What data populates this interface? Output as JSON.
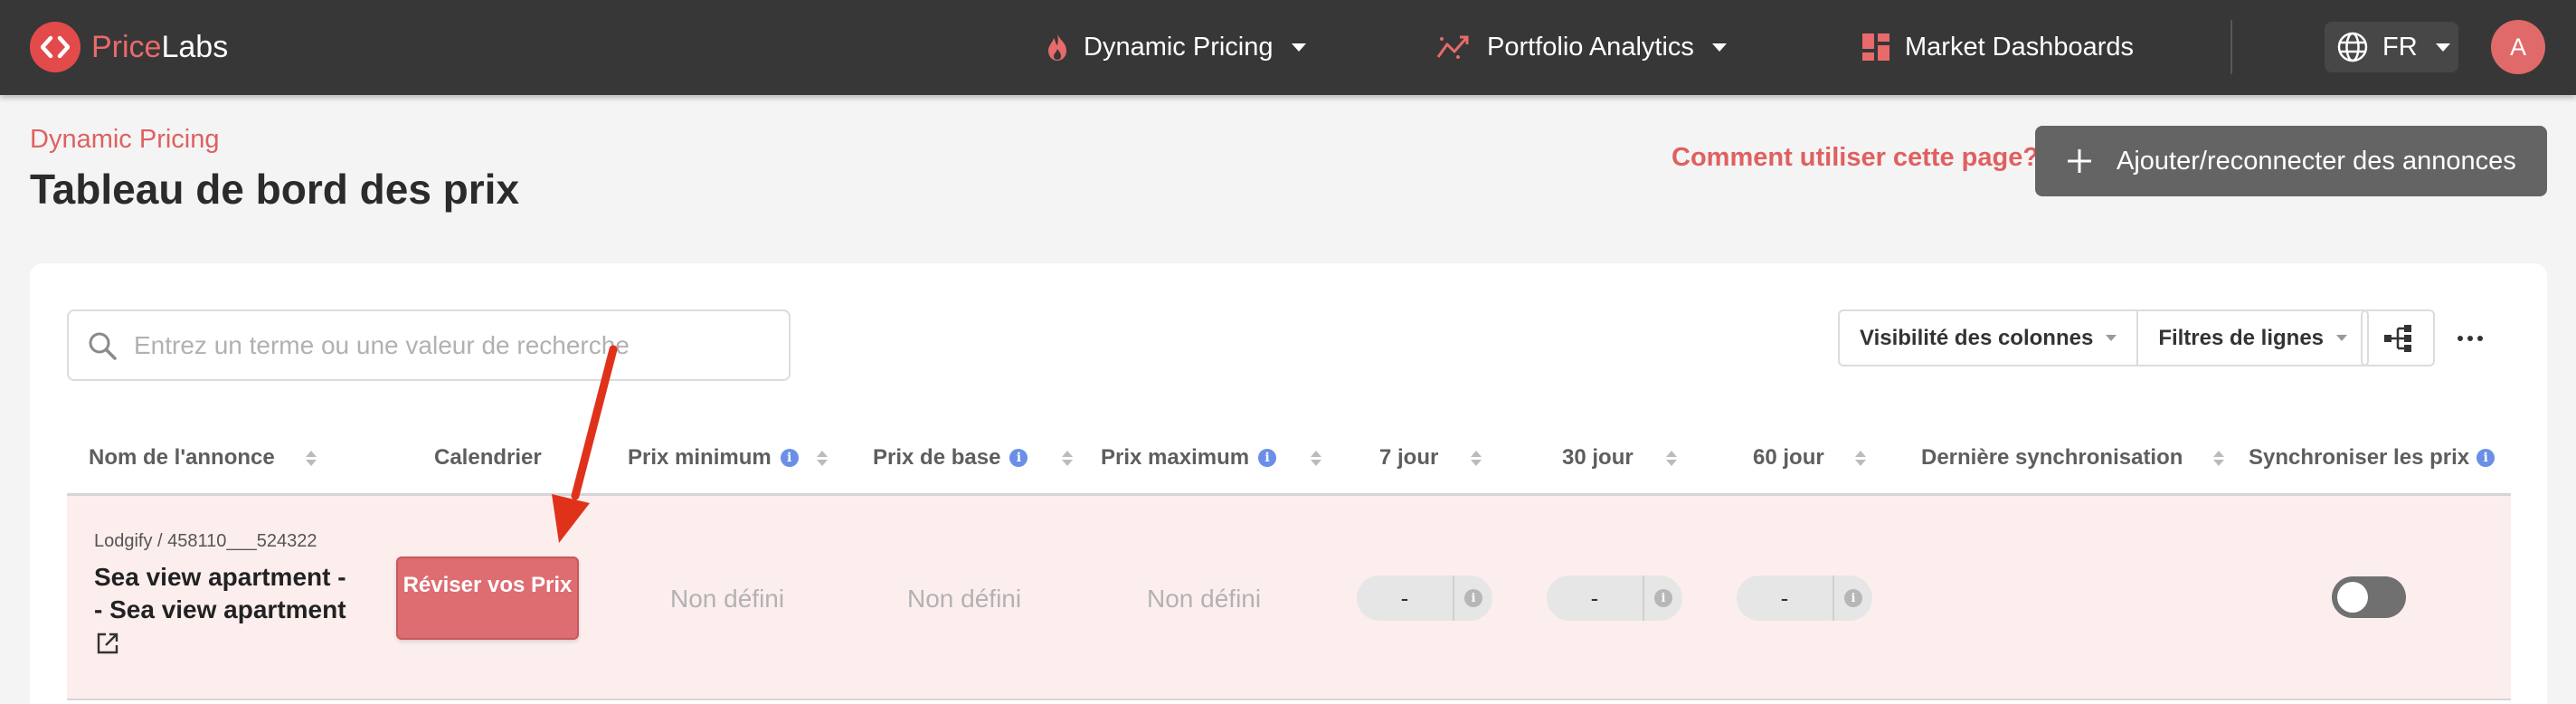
{
  "brand": {
    "name_first": "Price",
    "name_second": "Labs"
  },
  "nav": {
    "dynamic_pricing": "Dynamic Pricing",
    "portfolio_analytics": "Portfolio Analytics",
    "market_dashboards": "Market Dashboards",
    "language": "FR",
    "avatar_initial": "A"
  },
  "header": {
    "breadcrumb": "Dynamic Pricing",
    "title": "Tableau de bord des prix",
    "help_link": "Comment utiliser cette page?",
    "add_button": "Ajouter/reconnecter des annonces"
  },
  "toolbar": {
    "search_placeholder": "Entrez un terme ou une valeur de recherche",
    "column_visibility": "Visibilité des colonnes",
    "row_filters": "Filtres de lignes"
  },
  "table": {
    "columns": {
      "listing_name": "Nom de l'annonce",
      "calendar": "Calendrier",
      "min_price": "Prix minimum",
      "base_price": "Prix de base",
      "max_price": "Prix maximum",
      "day7": "7 jour",
      "day30": "30 jour",
      "day60": "60 jour",
      "last_sync": "Dernière synchronisation",
      "sync_prices": "Synchroniser les prix"
    },
    "rows": [
      {
        "source": "Lodgify / 458110___524322",
        "name": "Sea view apartment - - Sea view apartment",
        "review_button": "Réviser vos Prix",
        "min_price": "Non défini",
        "base_price": "Non défini",
        "max_price": "Non défini",
        "day7": "-",
        "day30": "-",
        "day60": "-",
        "last_sync": "",
        "sync_enabled": false
      }
    ]
  },
  "colors": {
    "accent": "#e06060",
    "navbar": "#373737",
    "row_highlight": "#fdeeee",
    "annotation_arrow": "#e0321b"
  }
}
